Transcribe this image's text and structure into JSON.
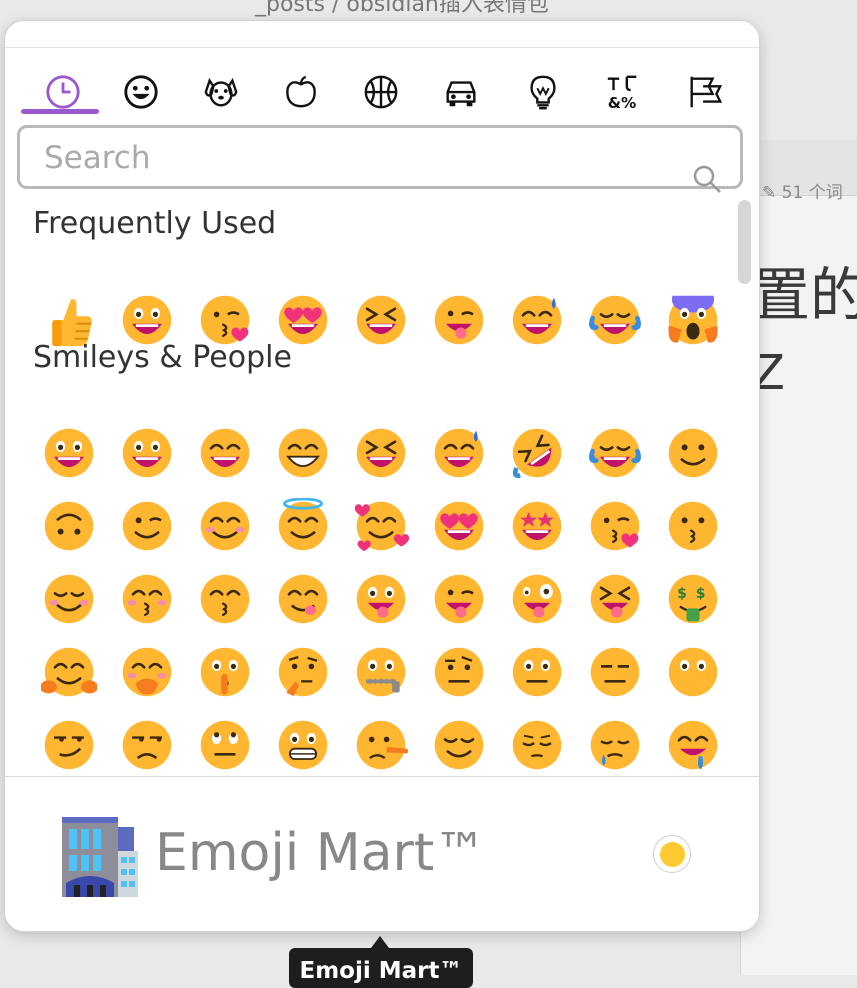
{
  "background": {
    "breadcrumb": "_posts / obsidian插入表情包",
    "word_count": "51 个词",
    "heading_fragment": "置的",
    "heading_fragment2": "Z"
  },
  "categories": [
    {
      "name": "frequent",
      "icon": "clock-icon",
      "active": true
    },
    {
      "name": "smileys",
      "icon": "smiley-icon"
    },
    {
      "name": "nature",
      "icon": "dog-icon"
    },
    {
      "name": "foods",
      "icon": "apple-icon"
    },
    {
      "name": "activity",
      "icon": "basketball-icon"
    },
    {
      "name": "places",
      "icon": "car-icon"
    },
    {
      "name": "objects",
      "icon": "lightbulb-icon"
    },
    {
      "name": "symbols",
      "icon": "symbols-icon"
    },
    {
      "name": "flags",
      "icon": "flags-icon"
    }
  ],
  "search": {
    "placeholder": "Search",
    "value": ""
  },
  "sections": {
    "frequent": {
      "title": "Frequently Used",
      "emojis": [
        "thumbs-up",
        "grinning-big-eyes",
        "kissing-heart",
        "heart-eyes",
        "squinting-laugh",
        "winking-tongue",
        "sweat-smile",
        "tears-of-joy",
        "screaming-fear"
      ]
    },
    "smileys": {
      "title": "Smileys & People",
      "rows": [
        [
          "grinning-big-eyes",
          "grinning-big-eyes",
          "beaming",
          "grimacing-grin",
          "squinting-laugh",
          "sweat-smile",
          "rofl",
          "tears-of-joy",
          "slight-smile"
        ],
        [
          "upside-down",
          "wink",
          "smiling-eyes-blush",
          "halo",
          "smiling-hearts",
          "heart-eyes",
          "star-struck",
          "kissing-heart",
          "kissing"
        ],
        [
          "relaxed",
          "kissing-closed-eyes",
          "kissing-smiling-eyes",
          "yum",
          "tongue",
          "winking-tongue",
          "zany",
          "squint-tongue",
          "money-mouth"
        ],
        [
          "hugging",
          "hand-over-mouth",
          "shushing",
          "thinking",
          "zipper-mouth",
          "raised-eyebrow",
          "neutral",
          "expressionless",
          "no-mouth"
        ],
        [
          "smirk",
          "unamused",
          "rolling-eyes",
          "grimacing",
          "lying",
          "relieved",
          "pensive",
          "sleepy",
          "drooling"
        ]
      ]
    }
  },
  "footer": {
    "title": "Emoji Mart™",
    "preview_icon": "office-building-icon",
    "skin_tone_color": "#ffc932"
  },
  "tooltip": {
    "text": "Emoji Mart™"
  },
  "colors": {
    "accent": "#9b59d0",
    "emoji_yellow": "#ffb631",
    "emoji_mouth": "#c1126b"
  }
}
